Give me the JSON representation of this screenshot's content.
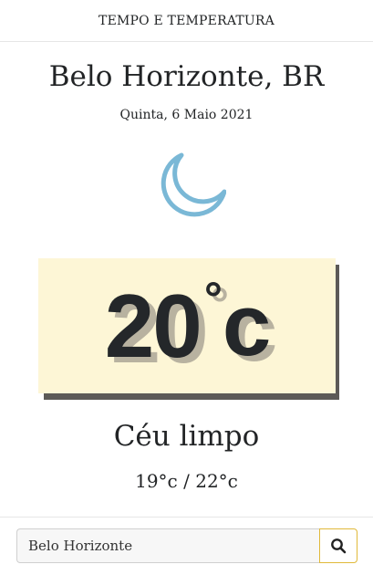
{
  "header": {
    "title": "TEMPO E TEMPERATURA"
  },
  "location": {
    "city": "Belo Horizonte, BR",
    "date": "Quinta, 6 Maio 2021"
  },
  "weather": {
    "icon": "moon-icon",
    "icon_color": "#7ab8d6",
    "temperature": "20",
    "degree_symbol": "°",
    "unit": "c",
    "condition": "Céu limpo",
    "min_max": "19°c / 22°c"
  },
  "colors": {
    "card_background": "#fdf6d6",
    "card_shadow": "#5c5a57",
    "search_button_border": "#e0b93a"
  },
  "search": {
    "value": "Belo Horizonte",
    "button_icon": "search-icon"
  }
}
